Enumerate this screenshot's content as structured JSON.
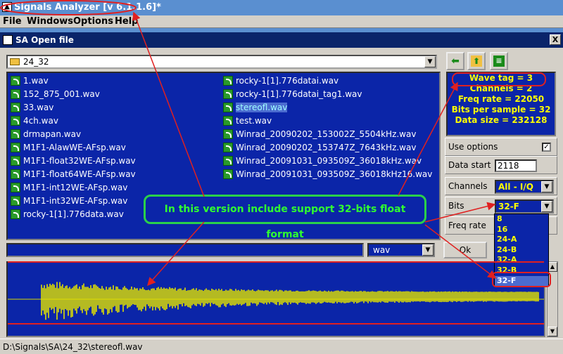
{
  "app": {
    "title": "Signals Analyzer [v 6.1.1.6]*",
    "icon": "app-icon"
  },
  "menu": [
    "File",
    "Windows",
    "Options",
    "Help"
  ],
  "dialog": {
    "title": "SA Open file",
    "close_label": "X",
    "folder": "24_32",
    "toolbar": [
      "back-arrow-icon",
      "up-folder-icon",
      "list-view-icon"
    ],
    "files_col1": [
      "1.wav",
      "152_875_001.wav",
      "33.wav",
      "4ch.wav",
      "drmapan.wav",
      "M1F1-AlawWE-AFsp.wav",
      "M1F1-float32WE-AFsp.wav",
      "M1F1-float64WE-AFsp.wav",
      "M1F1-int12WE-AFsp.wav",
      "M1F1-int32WE-AFsp.wav",
      "rocky-1[1].776data.wav"
    ],
    "files_col2": [
      "rocky-1[1].776datai.wav",
      "rocky-1[1].776datai_tag1.wav",
      "stereofl.wav",
      "test.wav",
      "Winrad_20090202_153002Z_5504kHz.wav",
      "Winrad_20090202_153747Z_7643kHz.wav",
      "Winrad_20091031_093509Z_36018kHz.wav",
      "Winrad_20091031_093509Z_36018kHz16.wav"
    ],
    "selected_file": "stereofl.wav",
    "info": {
      "wave_tag": "Wave tag = 3",
      "channels": "Channels = 2",
      "freq_rate": "Freq rate = 22050",
      "bits_per_sample": "Bits per sample = 32",
      "data_size": "Data size = 232128"
    },
    "options": {
      "use_options_label": "Use options",
      "use_options_checked": "✓",
      "data_start_label": "Data start",
      "data_start_value": "2118",
      "channels_label": "Channels",
      "channels_value": "All - I/Q",
      "bits_label": "Bits",
      "bits_value": "32-F",
      "freq_rate_label": "Freq rate",
      "bits_options": [
        "8",
        "16",
        "24-A",
        "24-B",
        "32-A",
        "32-B",
        "32-F"
      ]
    },
    "filename_value": "",
    "filetype": "wav",
    "ok_label": "Ok"
  },
  "status_path": "D:\\Signals\\SA\\24_32\\stereofl.wav",
  "annotation": {
    "callout_text": "In this version include support 32-bits float format",
    "color_red": "#e02020",
    "color_green": "#2ad04a"
  }
}
